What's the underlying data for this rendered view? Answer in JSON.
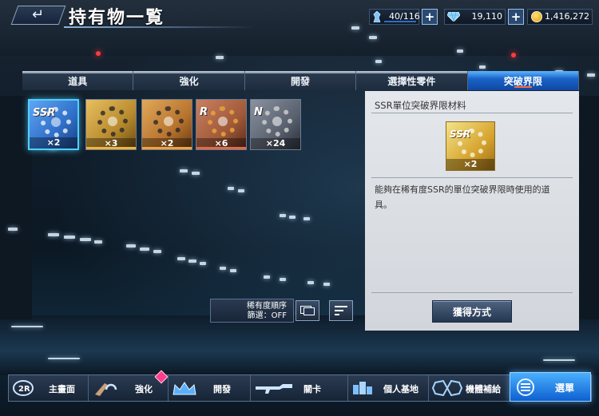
{
  "header": {
    "back_icon": "↵",
    "title": "持有物一覧",
    "capacity": "40/116",
    "gems": "19,110",
    "coins": "1,416,272"
  },
  "tabs": [
    {
      "label": "道具",
      "active": false
    },
    {
      "label": "強化",
      "active": false
    },
    {
      "label": "開發",
      "active": false
    },
    {
      "label": "選擇性零件",
      "active": false
    },
    {
      "label": "突破界限",
      "active": true
    }
  ],
  "items": [
    {
      "rank": "SSR",
      "count": "×2",
      "color": "#2f6fc8",
      "rarity_color": "#6fd3ff",
      "selected": true
    },
    {
      "rank": "SR",
      "count": "×3",
      "color": "#b88a2e",
      "rarity_color": "#f0b43c",
      "selected": false
    },
    {
      "rank": "SR",
      "count": "×2",
      "color": "#b8742e",
      "rarity_color": "#f0a23c",
      "selected": false
    },
    {
      "rank": "R",
      "count": "×6",
      "color": "#a05a3a",
      "rarity_color": "#e06a4a",
      "selected": false
    },
    {
      "rank": "N",
      "count": "×24",
      "color": "#5a6270",
      "rarity_color": "#9aa4b2",
      "selected": false
    }
  ],
  "sort": {
    "order_label": "稀有度順序",
    "filter_label": "篩選：OFF"
  },
  "detail": {
    "title": "SSR單位突破界限材料",
    "icon_rank": "SSR",
    "icon_count": "×2",
    "description": "能夠在稀有度SSR的單位突破界限時使用的道具。",
    "obtain_button": "獲得方式"
  },
  "bottom_nav": [
    {
      "label": "主畫面",
      "icon": "home-emblem-icon"
    },
    {
      "label": "強化",
      "icon": "wrench-icon"
    },
    {
      "label": "開發",
      "icon": "crown-icon"
    },
    {
      "label": "關卡",
      "icon": "rifle-icon"
    },
    {
      "label": "個人基地",
      "icon": "base-icon"
    },
    {
      "label": "機體補給",
      "icon": "mech-supply-icon"
    },
    {
      "label": "選單",
      "icon": "menu-icon"
    }
  ],
  "colors": {
    "accent": "#1a63c8",
    "active_tab_underline": "#ff6a3d",
    "selected_border": "#4fd0ff",
    "alert": "#ff3d8a"
  }
}
